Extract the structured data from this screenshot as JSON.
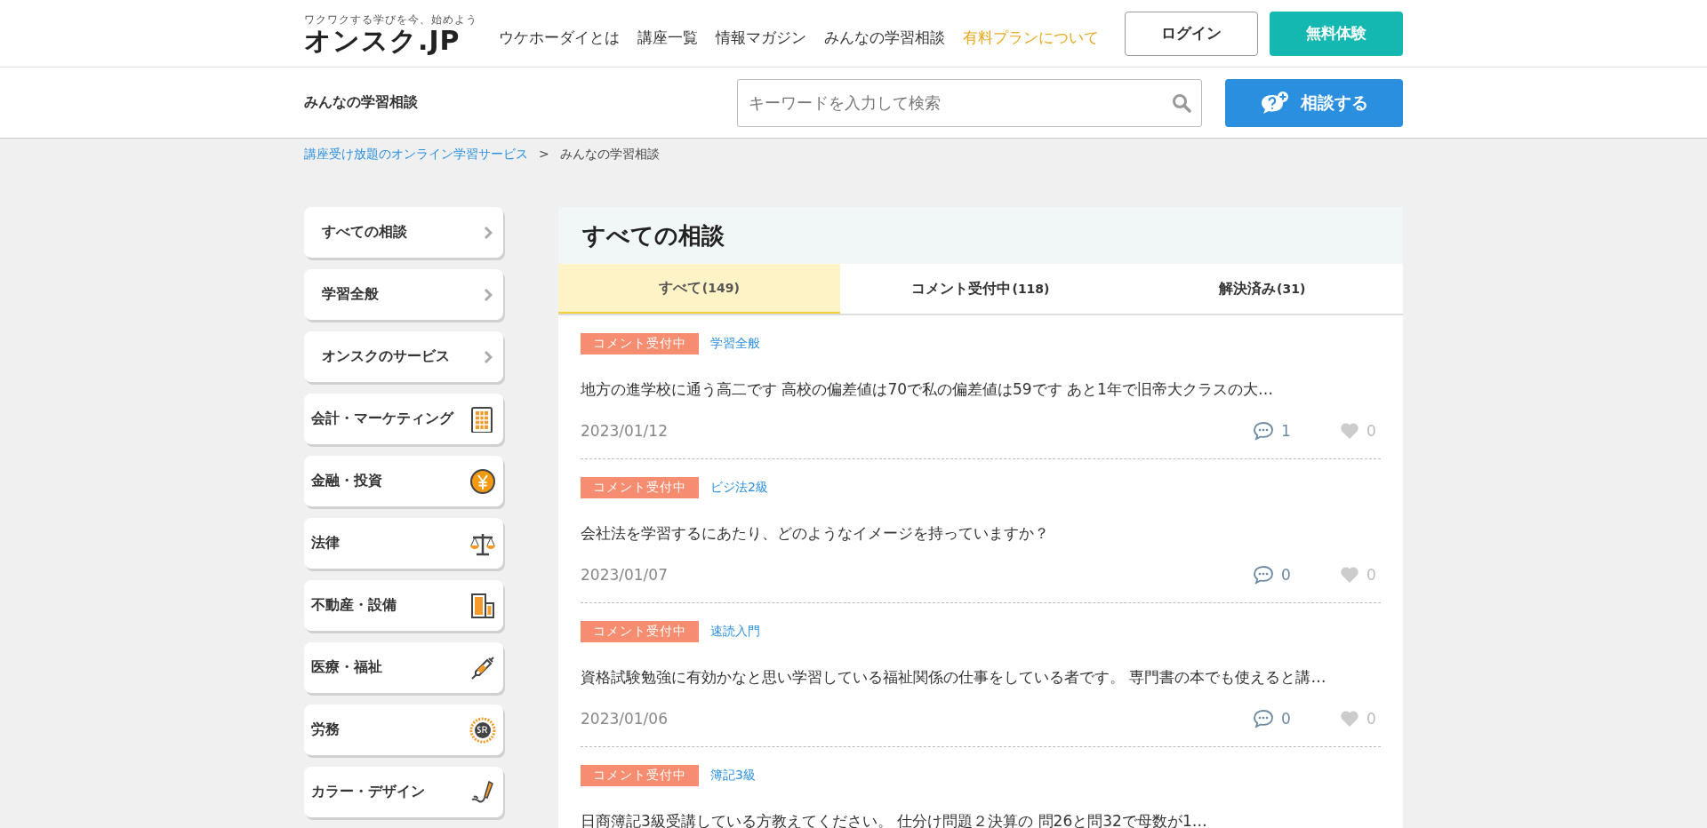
{
  "header": {
    "tagline": "ワクワクする学びを今、始めよう",
    "logo": "オンスク.JP",
    "nav": [
      {
        "label": "ウケホーダイとは",
        "highlight": false
      },
      {
        "label": "講座一覧",
        "highlight": false
      },
      {
        "label": "情報マガジン",
        "highlight": false
      },
      {
        "label": "みんなの学習相談",
        "highlight": false
      },
      {
        "label": "有料プランについて",
        "highlight": true
      }
    ],
    "login": "ログイン",
    "trial": "無料体験"
  },
  "subheader": {
    "title": "みんなの学習相談",
    "search": {
      "placeholder": "キーワードを入力して検索"
    },
    "ask": "相談する"
  },
  "breadcrumb": [
    {
      "label": "講座受け放題のオンライン学習サービス",
      "kind": "link"
    },
    {
      "label": ">",
      "kind": "separator"
    },
    {
      "label": "みんなの学習相談",
      "kind": "current"
    }
  ],
  "sidebar": {
    "items": [
      {
        "label": "すべての相談",
        "kind": "link"
      },
      {
        "label": "学習全般",
        "kind": "link"
      },
      {
        "label": "オンスクのサービス",
        "kind": "link"
      },
      {
        "label": "会計・マーケティング",
        "kind": "calculator"
      },
      {
        "label": "金融・投資",
        "kind": "yen"
      },
      {
        "label": "法律",
        "kind": "scales"
      },
      {
        "label": "不動産・設備",
        "kind": "building"
      },
      {
        "label": "医療・福祉",
        "kind": "syringe"
      },
      {
        "label": "労務",
        "kind": "seal"
      },
      {
        "label": "カラー・デザイン",
        "kind": "brush"
      }
    ]
  },
  "main": {
    "title": "すべての相談",
    "tabs": [
      {
        "label": "すべて",
        "count": "(149)",
        "selected": true
      },
      {
        "label": "コメント受付中",
        "count": "(118)",
        "selected": false
      },
      {
        "label": "解決済み",
        "count": "(31)",
        "selected": false
      }
    ],
    "posts": [
      {
        "status": "コメント受付中",
        "category": "学習全般",
        "text": "地方の進学校に通う高二です 高校の偏差値は70で私の偏差値は59です あと1年で旧帝大クラスの大…",
        "date": "2023/01/12",
        "comments": "1",
        "likes": "0"
      },
      {
        "status": "コメント受付中",
        "category": "ビジ法2級",
        "text": "会社法を学習するにあたり、どのようなイメージを持っていますか？",
        "date": "2023/01/07",
        "comments": "0",
        "likes": "0"
      },
      {
        "status": "コメント受付中",
        "category": "速読入門",
        "text": "資格試験勉強に有効かなと思い学習している福祉関係の仕事をしている者です。 専門書の本でも使えると講…",
        "date": "2023/01/06",
        "comments": "0",
        "likes": "0"
      },
      {
        "status": "コメント受付中",
        "category": "簿記3級",
        "text": "日商簿記3級受講している方教えてください。 仕分け問題２決算の 問26と問32で母数が1…"
      }
    ]
  }
}
